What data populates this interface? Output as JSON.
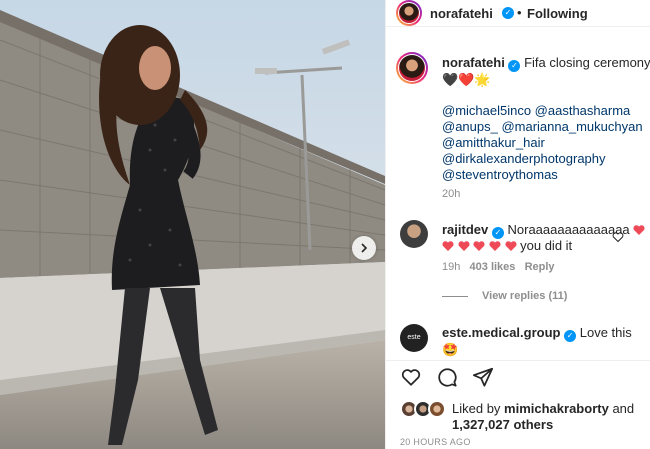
{
  "post": {
    "username": "norafatehi",
    "follow_state": "Following",
    "caption": "Fifa closing ceremony",
    "caption_emoji": "🖤❤️🌟",
    "mentions_line1": "@michael5inco @aasthasharma",
    "mentions_line2": "@anups_ @marianna_mukuchyan",
    "mentions_line3": "@amitthakur_hair",
    "mentions_line4": "@dirkalexanderphotography",
    "mentions_line5": "@steventroythomas",
    "caption_time": "20h"
  },
  "comments": [
    {
      "username": "rajitdev",
      "text_line1": "Noraaaaaaaaaaaaaa",
      "text_line2": "you did it",
      "time": "19h",
      "likes": "403 likes",
      "reply": "Reply",
      "view_replies": "View replies (11)"
    },
    {
      "username": "este.medical.group",
      "text": "Love this",
      "emoji": "🤩"
    }
  ],
  "likes": {
    "prefix": "Liked by",
    "user": "mimichakraborty",
    "and": "and",
    "count": "1,327,027 others"
  },
  "posted_ago": "20 HOURS AGO",
  "colors": {
    "verified": "#0095f6",
    "heart": "#ed4956",
    "mention": "#00376b"
  }
}
